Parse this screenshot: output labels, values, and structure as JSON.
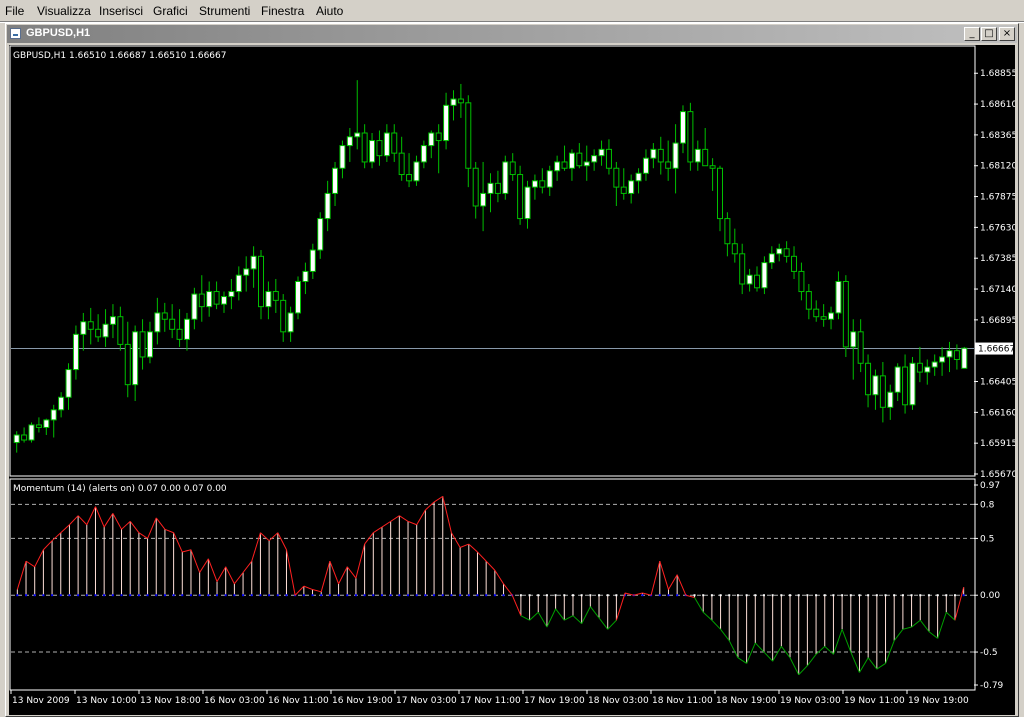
{
  "menu": [
    "File",
    "Visualizza",
    "Inserisci",
    "Grafici",
    "Strumenti",
    "Finestra",
    "Aiuto"
  ],
  "window": {
    "title": "GBPUSD,H1",
    "min_glyph": "_",
    "max_glyph": "□",
    "close_glyph": "×"
  },
  "price_panel": {
    "header": "GBPUSD,H1  1.66510 1.66687 1.66510 1.66667",
    "axis_labels": [
      "1.68855",
      "1.68610",
      "1.68365",
      "1.68120",
      "1.67875",
      "1.67630",
      "1.67385",
      "1.67140",
      "1.66895",
      "1.66667",
      "1.66405",
      "1.66160",
      "1.65915",
      "1.65670"
    ],
    "current_price": "1.66667"
  },
  "indicator_panel": {
    "header": "Momentum (14) (alerts on) 0.07 0.00 0.07 0.00",
    "axis_labels": [
      "0.97",
      "0.8",
      "0.5",
      "0.00",
      "-0.5",
      "-0.79"
    ]
  },
  "time_labels": [
    "13 Nov 2009",
    "13 Nov 10:00",
    "13 Nov 18:00",
    "16 Nov 03:00",
    "16 Nov 11:00",
    "16 Nov 19:00",
    "17 Nov 03:00",
    "17 Nov 11:00",
    "17 Nov 19:00",
    "18 Nov 03:00",
    "18 Nov 11:00",
    "18 Nov 19:00",
    "19 Nov 03:00",
    "19 Nov 11:00",
    "19 Nov 19:00"
  ],
  "colors": {
    "background": "#000000",
    "bull_candle": "#ffffff",
    "bear_candle": "#000000",
    "candle_wick": "#00c000",
    "grid_line": "#b0b0b0",
    "price_line": "#8899aa",
    "momentum_line": "#ff2020",
    "momentum_histogram": "#ffe0d8",
    "negative_line": "#00a000",
    "zero_dots": "#0000ff"
  },
  "chart_data": {
    "type": "candlestick",
    "symbol": "GBPUSD",
    "timeframe": "H1",
    "ylim": [
      1.6567,
      1.69
    ],
    "candles": [
      [
        1.6592,
        1.6601,
        1.6584,
        1.6598
      ],
      [
        1.6598,
        1.6604,
        1.6592,
        1.6594
      ],
      [
        1.6594,
        1.6608,
        1.6592,
        1.6606
      ],
      [
        1.6606,
        1.6612,
        1.66,
        1.6604
      ],
      [
        1.6604,
        1.6611,
        1.6598,
        1.661
      ],
      [
        1.661,
        1.6622,
        1.6596,
        1.6618
      ],
      [
        1.6618,
        1.6632,
        1.6612,
        1.6628
      ],
      [
        1.6628,
        1.6655,
        1.6618,
        1.665
      ],
      [
        1.665,
        1.6685,
        1.6642,
        1.6678
      ],
      [
        1.6678,
        1.6695,
        1.6665,
        1.6688
      ],
      [
        1.6688,
        1.6699,
        1.667,
        1.6682
      ],
      [
        1.6682,
        1.6694,
        1.6672,
        1.6676
      ],
      [
        1.6676,
        1.6698,
        1.6668,
        1.6686
      ],
      [
        1.6686,
        1.6702,
        1.6675,
        1.6692
      ],
      [
        1.6692,
        1.67,
        1.6665,
        1.667
      ],
      [
        1.667,
        1.6688,
        1.6628,
        1.6638
      ],
      [
        1.6638,
        1.6685,
        1.6625,
        1.668
      ],
      [
        1.668,
        1.669,
        1.665,
        1.666
      ],
      [
        1.666,
        1.6688,
        1.6655,
        1.668
      ],
      [
        1.668,
        1.6707,
        1.667,
        1.6695
      ],
      [
        1.6695,
        1.6703,
        1.668,
        1.669
      ],
      [
        1.669,
        1.6702,
        1.6675,
        1.6682
      ],
      [
        1.6682,
        1.6698,
        1.6668,
        1.6674
      ],
      [
        1.6674,
        1.6695,
        1.6665,
        1.669
      ],
      [
        1.669,
        1.6715,
        1.6682,
        1.671
      ],
      [
        1.671,
        1.6725,
        1.6688,
        1.67
      ],
      [
        1.67,
        1.672,
        1.6692,
        1.6712
      ],
      [
        1.6712,
        1.672,
        1.6698,
        1.6702
      ],
      [
        1.6702,
        1.6712,
        1.6695,
        1.6708
      ],
      [
        1.6708,
        1.6722,
        1.6698,
        1.6712
      ],
      [
        1.6712,
        1.6732,
        1.6705,
        1.6725
      ],
      [
        1.6725,
        1.674,
        1.6712,
        1.673
      ],
      [
        1.673,
        1.6748,
        1.6715,
        1.674
      ],
      [
        1.674,
        1.6745,
        1.669,
        1.67
      ],
      [
        1.67,
        1.672,
        1.669,
        1.6712
      ],
      [
        1.6712,
        1.6722,
        1.6695,
        1.6705
      ],
      [
        1.6705,
        1.671,
        1.6672,
        1.668
      ],
      [
        1.668,
        1.67,
        1.6672,
        1.6695
      ],
      [
        1.6695,
        1.6724,
        1.669,
        1.672
      ],
      [
        1.672,
        1.6735,
        1.671,
        1.6728
      ],
      [
        1.6728,
        1.675,
        1.6722,
        1.6745
      ],
      [
        1.6745,
        1.6775,
        1.6738,
        1.677
      ],
      [
        1.677,
        1.68,
        1.676,
        1.679
      ],
      [
        1.679,
        1.6815,
        1.678,
        1.681
      ],
      [
        1.681,
        1.6832,
        1.6802,
        1.6828
      ],
      [
        1.6828,
        1.6842,
        1.6815,
        1.6835
      ],
      [
        1.6835,
        1.688,
        1.6825,
        1.6838
      ],
      [
        1.6838,
        1.6845,
        1.681,
        1.6815
      ],
      [
        1.6815,
        1.6838,
        1.681,
        1.6832
      ],
      [
        1.6832,
        1.684,
        1.6812,
        1.682
      ],
      [
        1.682,
        1.6845,
        1.6815,
        1.6838
      ],
      [
        1.6838,
        1.6845,
        1.6815,
        1.6822
      ],
      [
        1.6822,
        1.6835,
        1.68,
        1.6805
      ],
      [
        1.6805,
        1.6822,
        1.6795,
        1.68
      ],
      [
        1.68,
        1.682,
        1.6796,
        1.6815
      ],
      [
        1.6815,
        1.6832,
        1.681,
        1.6828
      ],
      [
        1.6828,
        1.684,
        1.6818,
        1.6838
      ],
      [
        1.6838,
        1.6845,
        1.6806,
        1.6832
      ],
      [
        1.6832,
        1.687,
        1.6825,
        1.686
      ],
      [
        1.686,
        1.6872,
        1.6848,
        1.6865
      ],
      [
        1.6865,
        1.6877,
        1.685,
        1.6862
      ],
      [
        1.6862,
        1.6868,
        1.6795,
        1.681
      ],
      [
        1.681,
        1.6815,
        1.677,
        1.678
      ],
      [
        1.678,
        1.6815,
        1.676,
        1.679
      ],
      [
        1.679,
        1.6806,
        1.6775,
        1.6798
      ],
      [
        1.6798,
        1.6808,
        1.6783,
        1.679
      ],
      [
        1.679,
        1.682,
        1.6785,
        1.6815
      ],
      [
        1.6815,
        1.6822,
        1.68,
        1.6805
      ],
      [
        1.6805,
        1.6812,
        1.6765,
        1.677
      ],
      [
        1.677,
        1.68,
        1.6762,
        1.6795
      ],
      [
        1.6795,
        1.6805,
        1.6785,
        1.68
      ],
      [
        1.68,
        1.681,
        1.679,
        1.6795
      ],
      [
        1.6795,
        1.6812,
        1.6788,
        1.6808
      ],
      [
        1.6808,
        1.682,
        1.68,
        1.6815
      ],
      [
        1.6815,
        1.6828,
        1.6808,
        1.681
      ],
      [
        1.681,
        1.6825,
        1.68,
        1.6822
      ],
      [
        1.6822,
        1.683,
        1.681,
        1.6812
      ],
      [
        1.6812,
        1.6828,
        1.68,
        1.6815
      ],
      [
        1.6815,
        1.6825,
        1.6808,
        1.682
      ],
      [
        1.682,
        1.6832,
        1.6812,
        1.6825
      ],
      [
        1.6825,
        1.6833,
        1.6805,
        1.681
      ],
      [
        1.681,
        1.6815,
        1.678,
        1.6795
      ],
      [
        1.6795,
        1.681,
        1.6785,
        1.679
      ],
      [
        1.679,
        1.6805,
        1.6782,
        1.68
      ],
      [
        1.68,
        1.681,
        1.679,
        1.6806
      ],
      [
        1.6806,
        1.6825,
        1.68,
        1.6818
      ],
      [
        1.6818,
        1.683,
        1.681,
        1.6825
      ],
      [
        1.6825,
        1.6835,
        1.6805,
        1.6815
      ],
      [
        1.6815,
        1.6832,
        1.68,
        1.681
      ],
      [
        1.681,
        1.6845,
        1.679,
        1.683
      ],
      [
        1.683,
        1.686,
        1.6822,
        1.6855
      ],
      [
        1.6855,
        1.6862,
        1.6808,
        1.6815
      ],
      [
        1.6815,
        1.6832,
        1.6808,
        1.6825
      ],
      [
        1.6825,
        1.6842,
        1.6818,
        1.6812
      ],
      [
        1.6812,
        1.6818,
        1.6792,
        1.681
      ],
      [
        1.681,
        1.6812,
        1.676,
        1.677
      ],
      [
        1.677,
        1.6775,
        1.674,
        1.675
      ],
      [
        1.675,
        1.6762,
        1.6735,
        1.6742
      ],
      [
        1.6742,
        1.675,
        1.671,
        1.6718
      ],
      [
        1.6718,
        1.673,
        1.6712,
        1.6725
      ],
      [
        1.6725,
        1.6732,
        1.6712,
        1.6715
      ],
      [
        1.6715,
        1.674,
        1.671,
        1.6735
      ],
      [
        1.6735,
        1.6748,
        1.673,
        1.6742
      ],
      [
        1.6742,
        1.675,
        1.6736,
        1.6746
      ],
      [
        1.6746,
        1.6752,
        1.6735,
        1.674
      ],
      [
        1.674,
        1.6748,
        1.6722,
        1.6728
      ],
      [
        1.6728,
        1.6735,
        1.6705,
        1.6712
      ],
      [
        1.6712,
        1.6718,
        1.669,
        1.6698
      ],
      [
        1.6698,
        1.6705,
        1.6688,
        1.6692
      ],
      [
        1.6692,
        1.6702,
        1.6684,
        1.669
      ],
      [
        1.669,
        1.67,
        1.6682,
        1.6695
      ],
      [
        1.6695,
        1.6728,
        1.669,
        1.672
      ],
      [
        1.672,
        1.6725,
        1.666,
        1.6668
      ],
      [
        1.6668,
        1.669,
        1.6642,
        1.668
      ],
      [
        1.668,
        1.669,
        1.6648,
        1.6655
      ],
      [
        1.6655,
        1.6662,
        1.662,
        1.663
      ],
      [
        1.663,
        1.665,
        1.6618,
        1.6645
      ],
      [
        1.6645,
        1.6656,
        1.6608,
        1.662
      ],
      [
        1.662,
        1.6638,
        1.661,
        1.6632
      ],
      [
        1.6632,
        1.6655,
        1.6625,
        1.6652
      ],
      [
        1.6652,
        1.6662,
        1.6615,
        1.6622
      ],
      [
        1.6622,
        1.666,
        1.6618,
        1.6655
      ],
      [
        1.6655,
        1.6668,
        1.664,
        1.6648
      ],
      [
        1.6648,
        1.6658,
        1.6638,
        1.6652
      ],
      [
        1.6652,
        1.6662,
        1.6645,
        1.6656
      ],
      [
        1.6656,
        1.6668,
        1.6645,
        1.666
      ],
      [
        1.666,
        1.6672,
        1.6648,
        1.6665
      ],
      [
        1.6665,
        1.667,
        1.665,
        1.6658
      ],
      [
        1.6651,
        1.6668,
        1.6651,
        1.6667
      ]
    ],
    "momentum": {
      "name": "Momentum (14)",
      "ylim": [
        -0.79,
        0.97
      ],
      "levels": [
        0.8,
        0.5,
        0.0,
        -0.5
      ],
      "values": [
        0.05,
        0.3,
        0.25,
        0.4,
        0.48,
        0.55,
        0.62,
        0.7,
        0.62,
        0.78,
        0.6,
        0.72,
        0.58,
        0.65,
        0.55,
        0.5,
        0.68,
        0.58,
        0.55,
        0.38,
        0.4,
        0.2,
        0.32,
        0.12,
        0.25,
        0.1,
        0.2,
        0.3,
        0.55,
        0.48,
        0.55,
        0.4,
        0.0,
        0.08,
        0.05,
        0.03,
        0.3,
        0.1,
        0.25,
        0.15,
        0.45,
        0.55,
        0.6,
        0.65,
        0.7,
        0.65,
        0.62,
        0.75,
        0.82,
        0.87,
        0.55,
        0.42,
        0.45,
        0.38,
        0.3,
        0.22,
        0.1,
        0.0,
        -0.18,
        -0.22,
        -0.15,
        -0.28,
        -0.12,
        -0.22,
        -0.18,
        -0.25,
        -0.1,
        -0.2,
        -0.3,
        -0.22,
        0.02,
        0.0,
        0.02,
        0.0,
        0.3,
        0.05,
        0.18,
        0.0,
        -0.02,
        -0.15,
        -0.22,
        -0.3,
        -0.4,
        -0.55,
        -0.6,
        -0.42,
        -0.5,
        -0.58,
        -0.45,
        -0.55,
        -0.7,
        -0.62,
        -0.52,
        -0.45,
        -0.52,
        -0.3,
        -0.5,
        -0.68,
        -0.55,
        -0.65,
        -0.6,
        -0.4,
        -0.3,
        -0.28,
        -0.22,
        -0.32,
        -0.38,
        -0.15,
        -0.22,
        0.07
      ]
    }
  }
}
